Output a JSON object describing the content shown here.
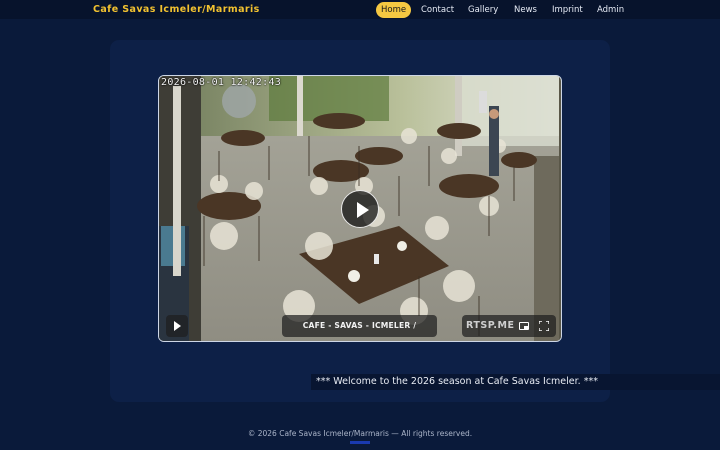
{
  "site": {
    "brand": "Cafe Savas Icmeler/Marmaris"
  },
  "nav": {
    "items": [
      {
        "label": "Home",
        "active": true
      },
      {
        "label": "Contact",
        "active": false
      },
      {
        "label": "Gallery",
        "active": false
      },
      {
        "label": "News",
        "active": false
      },
      {
        "label": "Imprint",
        "active": false
      },
      {
        "label": "Admin",
        "active": false
      }
    ]
  },
  "player": {
    "timestamp": "2026-08-01 12:42:43",
    "caption": "CAFE - SAVAS - ICMELER / MARMARIS",
    "logo": "RTSP.ME",
    "icons": [
      "play-icon",
      "picture-in-picture-icon",
      "fullscreen-icon"
    ]
  },
  "marquee": {
    "text": "*** Welcome to the 2026 season at Cafe Savas Icmeler. ***"
  },
  "footer": {
    "text": "© 2026 Cafe Savas Icmeler/Marmaris — All rights reserved."
  },
  "colors": {
    "background": "#0a1a3a",
    "accent": "#f5c842",
    "brand": "#f2c230"
  }
}
